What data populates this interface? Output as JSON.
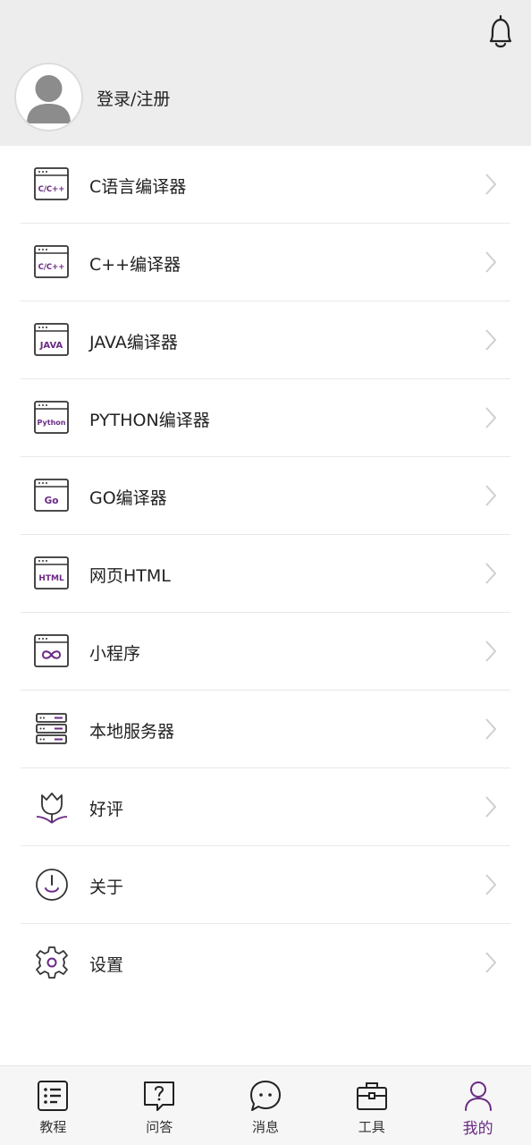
{
  "header": {
    "login_label": "登录/注册"
  },
  "menu": {
    "items": [
      {
        "label": "C语言编译器",
        "icon": "c-compiler-icon",
        "icon_text": "C/C++"
      },
      {
        "label": "C++编译器",
        "icon": "cpp-compiler-icon",
        "icon_text": "C/C++"
      },
      {
        "label": "JAVA编译器",
        "icon": "java-compiler-icon",
        "icon_text": "JAVA"
      },
      {
        "label": "PYTHON编译器",
        "icon": "python-compiler-icon",
        "icon_text": "Python"
      },
      {
        "label": "GO编译器",
        "icon": "go-compiler-icon",
        "icon_text": "Go"
      },
      {
        "label": "网页HTML",
        "icon": "html-icon",
        "icon_text": "HTML"
      },
      {
        "label": "小程序",
        "icon": "mini-program-icon"
      },
      {
        "label": "本地服务器",
        "icon": "server-icon"
      },
      {
        "label": "好评",
        "icon": "flower-icon"
      },
      {
        "label": "关于",
        "icon": "about-icon"
      },
      {
        "label": "设置",
        "icon": "gear-icon"
      }
    ]
  },
  "tabbar": {
    "tabs": [
      {
        "label": "教程",
        "icon": "tutorial-icon"
      },
      {
        "label": "问答",
        "icon": "qa-icon"
      },
      {
        "label": "消息",
        "icon": "message-icon"
      },
      {
        "label": "工具",
        "icon": "toolbox-icon"
      },
      {
        "label": "我的",
        "icon": "profile-icon",
        "active": true
      }
    ]
  },
  "colors": {
    "accent": "#6a2a85",
    "header_bg": "#ededed",
    "tabbar_bg": "#f6f6f6",
    "divider": "#e8e8e8"
  }
}
